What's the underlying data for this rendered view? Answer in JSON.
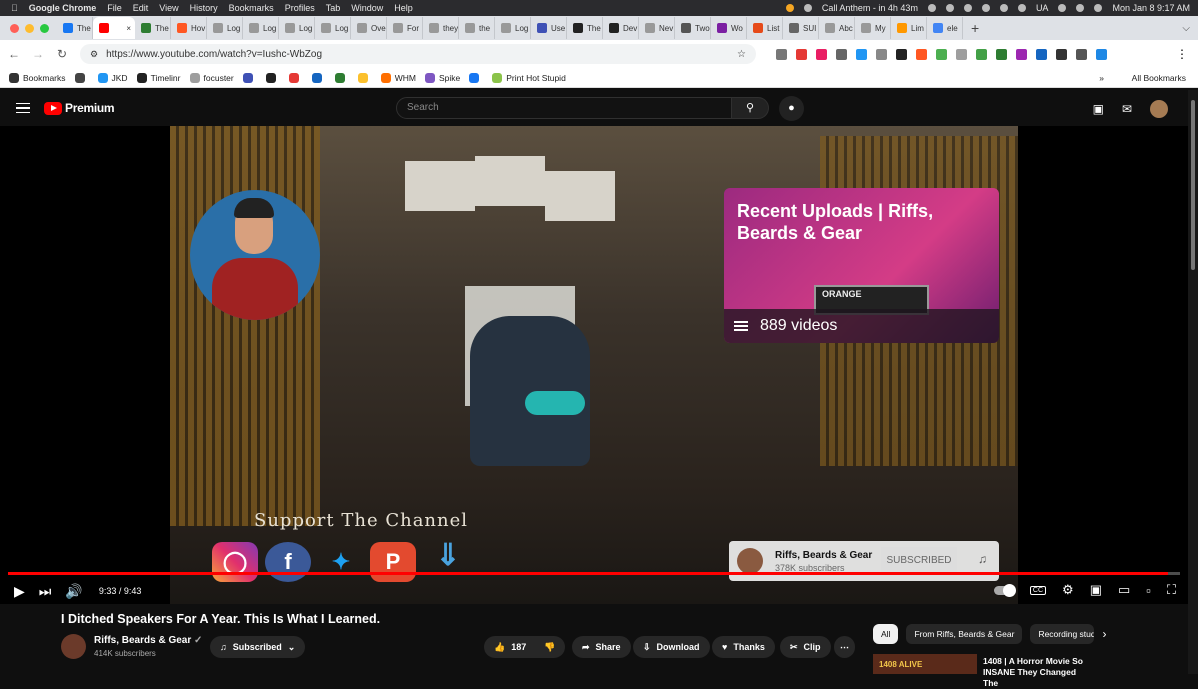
{
  "menubar": {
    "app": "Google Chrome",
    "items": [
      "File",
      "Edit",
      "View",
      "History",
      "Bookmarks",
      "Profiles",
      "Tab",
      "Window",
      "Help"
    ],
    "call": "Call Anthem - in 4h 43m",
    "ua": "UA",
    "datetime": "Mon Jan 8  9:17 AM"
  },
  "tabs": [
    {
      "label": "The",
      "color": "#1877f2"
    },
    {
      "label": "",
      "color": "#ff0000",
      "active": true
    },
    {
      "label": "The",
      "color": "#2e7d32"
    },
    {
      "label": "Hov",
      "color": "#ff5722"
    },
    {
      "label": "Log",
      "color": "#999999"
    },
    {
      "label": "Log",
      "color": "#999999"
    },
    {
      "label": "Log",
      "color": "#999999"
    },
    {
      "label": "Log",
      "color": "#999999"
    },
    {
      "label": "Ove",
      "color": "#999999"
    },
    {
      "label": "For",
      "color": "#999999"
    },
    {
      "label": "they",
      "color": "#999999"
    },
    {
      "label": "the",
      "color": "#999999"
    },
    {
      "label": "Log",
      "color": "#999999"
    },
    {
      "label": "Use",
      "color": "#3f51b5"
    },
    {
      "label": "The",
      "color": "#222222"
    },
    {
      "label": "Dev",
      "color": "#222222"
    },
    {
      "label": "Nev",
      "color": "#999999"
    },
    {
      "label": "Two",
      "color": "#555555"
    },
    {
      "label": "Wo",
      "color": "#7b1fa2"
    },
    {
      "label": "List",
      "color": "#e64a19"
    },
    {
      "label": "SUI",
      "color": "#666666"
    },
    {
      "label": "Abc",
      "color": "#999999"
    },
    {
      "label": "My",
      "color": "#999999"
    },
    {
      "label": "Lim",
      "color": "#ff9800"
    },
    {
      "label": "ele",
      "color": "#4285f4"
    }
  ],
  "address": {
    "url": "https://www.youtube.com/watch?v=Iushc-WbZog"
  },
  "bookmarks": {
    "items": [
      {
        "label": "Bookmarks",
        "color": "#333333"
      },
      {
        "label": "",
        "color": "#444444"
      },
      {
        "label": "JKD",
        "color": "#2196f3"
      },
      {
        "label": "Timelinr",
        "color": "#222222"
      },
      {
        "label": "focuster",
        "color": "#9e9e9e"
      },
      {
        "label": "",
        "color": "#3f51b5"
      },
      {
        "label": "",
        "color": "#222222"
      },
      {
        "label": "",
        "color": "#e53935"
      },
      {
        "label": "",
        "color": "#1565c0"
      },
      {
        "label": "",
        "color": "#2e7d32"
      },
      {
        "label": "",
        "color": "#fbc02d"
      },
      {
        "label": "WHM",
        "color": "#ff6f00"
      },
      {
        "label": "Spike",
        "color": "#7e57c2"
      },
      {
        "label": "",
        "color": "#1877f2"
      },
      {
        "label": "Print Hot Stupid",
        "color": "#8bc34a"
      }
    ],
    "all": "All Bookmarks"
  },
  "youtube": {
    "logo": "Premium",
    "search_placeholder": "Search"
  },
  "video": {
    "card_title": "Recent Uploads | Riffs, Beards & Gear",
    "card_count": "889 videos",
    "amp_label": "ORANGE",
    "support_text": "Support The Channel",
    "sub_card_name": "Riffs, Beards & Gear",
    "sub_card_subs": "378K subscribers",
    "sub_card_button": "SUBSCRIBED",
    "progress": 0.99,
    "time": "9:33 / 9:43"
  },
  "below": {
    "title": "I Ditched Speakers For A Year. This Is What I Learned.",
    "channel": "Riffs, Beards & Gear",
    "subs": "414K subscribers",
    "subscribed": "Subscribed",
    "likes": "187",
    "share": "Share",
    "download": "Download",
    "thanks": "Thanks",
    "clip": "Clip",
    "chips": [
      "All",
      "From Riffs, Beards & Gear",
      "Recording stud"
    ],
    "rec_title": "1408 | A Horror Movie So INSANE They Changed The",
    "rec_thumb_text": "1408 ALIVE"
  },
  "colors": {
    "accent": "#ff0000",
    "background": "#0f0f0f"
  }
}
